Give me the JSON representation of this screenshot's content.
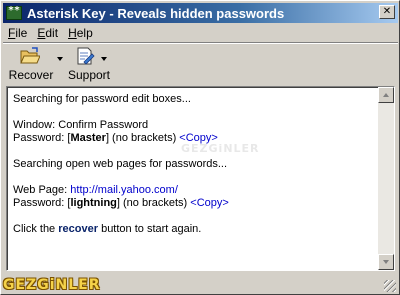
{
  "window": {
    "title": "Asterisk Key - Reveals hidden passwords",
    "close_label": "✕"
  },
  "menu": {
    "items": [
      {
        "label": "File",
        "accel": "F",
        "rest": "ile"
      },
      {
        "label": "Edit",
        "accel": "E",
        "rest": "dit"
      },
      {
        "label": "Help",
        "accel": "H",
        "rest": "elp"
      }
    ]
  },
  "toolbar": {
    "recover_label": "Recover",
    "recover_icon": "folder-open-icon",
    "support_label": "Support",
    "support_icon": "document-edit-icon"
  },
  "output": {
    "line1": "Searching for password edit boxes...",
    "window_prefix": "Window: ",
    "window_name": "Confirm Password",
    "pw1_prefix": "Password: [",
    "pw1_value": "Master",
    "pw1_suffix": "] (no brackets) ",
    "copy_link": "<Copy>",
    "line_web": "Searching open web pages for passwords...",
    "webpage_prefix": "Web Page: ",
    "webpage_url": "http://mail.yahoo.com/",
    "pw2_prefix": "Password: [",
    "pw2_value": "lightning",
    "pw2_suffix": "] (no brackets) ",
    "click_prefix": "Click the ",
    "click_bold": "recover",
    "click_suffix": " button to start again."
  },
  "watermark": {
    "text": "GEZGiNLER",
    "faint_text": "GEZGiNLER"
  },
  "colors": {
    "title_bar": "#0a246a",
    "link": "#0000cc",
    "window_bg": "#d4d0c8"
  }
}
